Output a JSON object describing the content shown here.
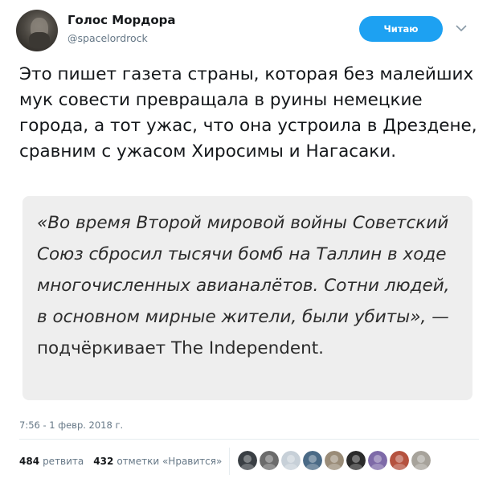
{
  "author": {
    "display_name": "Голос Мордора",
    "handle": "@spacelordrock"
  },
  "follow_button": {
    "label": "Читаю"
  },
  "tweet": {
    "text": "Это пишет газета страны, которая без малейших мук совести превращала в руины немецкие города, а тот ужас, что она устроила в Дрездене, сравним с ужасом Хиросимы и Нагасаки.",
    "quote_italic": "«Во время Второй мировой войны Советский Союз сбросил тысячи бомб на Таллин в ходе многочисленных авианалётов. Сотни людей, в основном мирные жители, были убиты», —",
    "quote_plain": "подчёркивает The Independent.",
    "timestamp": "7:56 - 1 февр. 2018 г."
  },
  "stats": {
    "retweets_count": "484",
    "retweets_label": "ретвита",
    "likes_count": "432",
    "likes_label": "отметки «Нравится»"
  },
  "likers": [
    {
      "icon": "avatar",
      "color": "#3a3f44"
    },
    {
      "icon": "avatar",
      "color": "#6b6b6b"
    },
    {
      "icon": "avatar",
      "color": "#c7d0d8"
    },
    {
      "icon": "avatar",
      "color": "#4a6a86"
    },
    {
      "icon": "avatar",
      "color": "#9a8c78"
    },
    {
      "icon": "avatar",
      "color": "#2b2b2b"
    },
    {
      "icon": "avatar",
      "color": "#7e6aa8"
    },
    {
      "icon": "avatar",
      "color": "#b5523f"
    },
    {
      "icon": "avatar",
      "color": "#a7a39b"
    }
  ],
  "colors": {
    "accent": "#1da1f2",
    "secondary_text": "#657786",
    "quote_background": "#eeeeee"
  }
}
